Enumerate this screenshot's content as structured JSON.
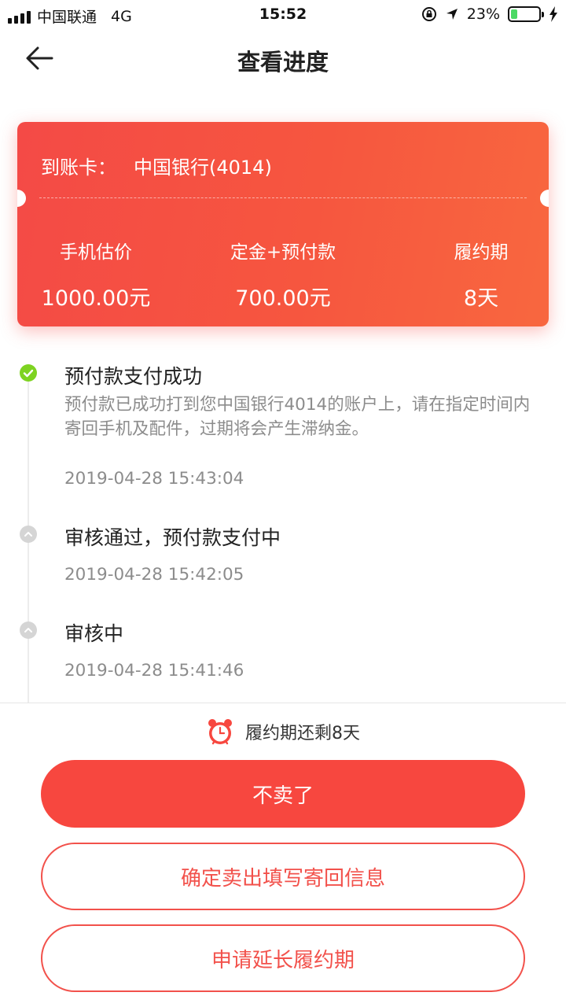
{
  "status_bar": {
    "carrier": "中国联通",
    "network": "4G",
    "time": "15:52",
    "battery": "23%",
    "battery_level": 0.23
  },
  "header": {
    "title": "查看进度"
  },
  "card": {
    "account_label": "到账卡：",
    "account_value": "中国银行(4014)",
    "stats": [
      {
        "label": "手机估价",
        "value": "1000.00元"
      },
      {
        "label": "定金+预付款",
        "value": "700.00元"
      },
      {
        "label": "履约期",
        "value": "8天"
      }
    ]
  },
  "timeline": [
    {
      "title": "预付款支付成功",
      "description": "预付款已成功打到您中国银行4014的账户上，请在指定时间内寄回手机及配件，过期将会产生滞纳金。",
      "time": "2019-04-28 15:43:04",
      "status": "done"
    },
    {
      "title": "审核通过，预付款支付中",
      "time": "2019-04-28 15:42:05",
      "status": "pending"
    },
    {
      "title": "审核中",
      "time": "2019-04-28 15:41:46",
      "status": "pending"
    }
  ],
  "footer": {
    "remaining_text": "履约期还剩8天",
    "buttons": {
      "cancel": "不卖了",
      "confirm": "确定卖出填写寄回信息",
      "extend": "申请延长履约期"
    }
  },
  "colors": {
    "accent": "#f7473f",
    "success": "#7ed321"
  }
}
